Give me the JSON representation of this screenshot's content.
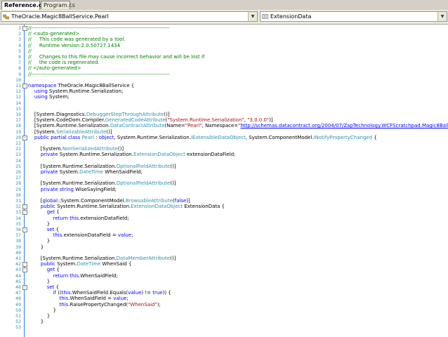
{
  "tabs": [
    {
      "label": "Reference.cs",
      "active": true
    },
    {
      "label": "Program.cs",
      "active": false
    }
  ],
  "type_combo": {
    "value": "TheOracle.Magic8BallService.Pearl",
    "icon": "class-icon"
  },
  "member_combo": {
    "value": "ExtensionData",
    "icon": "property-icon"
  },
  "lines": [
    {
      "n": "1",
      "fold": "-",
      "t": [
        [
          "c",
          "//------------------------------------------------------------------------------"
        ]
      ]
    },
    {
      "n": "2",
      "t": [
        [
          "c",
          "// <auto-generated>"
        ]
      ]
    },
    {
      "n": "3",
      "t": [
        [
          "c",
          "//     This code was generated by a tool."
        ]
      ]
    },
    {
      "n": "4",
      "t": [
        [
          "c",
          "//     Runtime Version:2.0.50727.1434"
        ]
      ]
    },
    {
      "n": "5",
      "t": [
        [
          "c",
          "//"
        ]
      ]
    },
    {
      "n": "6",
      "t": [
        [
          "c",
          "//     Changes to this file may cause incorrect behavior and will be lost if"
        ]
      ]
    },
    {
      "n": "7",
      "t": [
        [
          "c",
          "//     the code is regenerated."
        ]
      ]
    },
    {
      "n": "8",
      "t": [
        [
          "c",
          "// </auto-generated>"
        ]
      ]
    },
    {
      "n": "9",
      "t": [
        [
          "c",
          "//------------------------------------------------------------------------------"
        ]
      ]
    },
    {
      "n": "10",
      "t": []
    },
    {
      "n": "11",
      "fold": "-",
      "t": [
        [
          "k",
          "namespace"
        ],
        [
          "n",
          " TheOracle.Magic8BallService {"
        ]
      ]
    },
    {
      "n": "12",
      "t": [
        [
          "n",
          "    "
        ],
        [
          "k",
          "using"
        ],
        [
          "n",
          " System.Runtime.Serialization;"
        ]
      ]
    },
    {
      "n": "13",
      "t": [
        [
          "n",
          "    "
        ],
        [
          "k",
          "using"
        ],
        [
          "n",
          " System;"
        ]
      ]
    },
    {
      "n": "14",
      "t": []
    },
    {
      "n": "15",
      "t": []
    },
    {
      "n": "16",
      "t": [
        [
          "n",
          "    [System.Diagnostics."
        ],
        [
          "t",
          "DebuggerStepThroughAttribute"
        ],
        [
          "n",
          "()]"
        ]
      ]
    },
    {
      "n": "17",
      "t": [
        [
          "n",
          "    [System.CodeDom.Compiler."
        ],
        [
          "t",
          "GeneratedCodeAttribute"
        ],
        [
          "n",
          "("
        ],
        [
          "s",
          "\"System.Runtime.Serialization\""
        ],
        [
          "n",
          ", "
        ],
        [
          "s",
          "\"3.0.0.0\""
        ],
        [
          "n",
          ")]"
        ]
      ]
    },
    {
      "n": "18",
      "t": [
        [
          "n",
          "    [System.Runtime.Serialization."
        ],
        [
          "t",
          "DataContractAttribute"
        ],
        [
          "n",
          "(Name="
        ],
        [
          "s",
          "\"Pearl\""
        ],
        [
          "n",
          ", Namespace="
        ],
        [
          "s",
          "\""
        ],
        [
          "u",
          "http://schemas.datacontract.org/2004/07/ZapTechnology.WCFScratchpad.Magic8Ball"
        ],
        [
          "s",
          "\""
        ],
        [
          "n",
          ")]"
        ]
      ]
    },
    {
      "n": "19",
      "t": [
        [
          "n",
          "    [System."
        ],
        [
          "t",
          "SerializableAttribute"
        ],
        [
          "n",
          "()]"
        ]
      ]
    },
    {
      "n": "20",
      "fold": "-",
      "t": [
        [
          "n",
          "    "
        ],
        [
          "k",
          "public partial class"
        ],
        [
          "n",
          " "
        ],
        [
          "t",
          "Pearl"
        ],
        [
          "n",
          " : "
        ],
        [
          "k",
          "object"
        ],
        [
          "n",
          ", System.Runtime.Serialization."
        ],
        [
          "t",
          "IExtensibleDataObject"
        ],
        [
          "n",
          ", System.ComponentModel."
        ],
        [
          "t",
          "INotifyPropertyChanged"
        ],
        [
          "n",
          " {"
        ]
      ]
    },
    {
      "n": "21",
      "t": []
    },
    {
      "n": "22",
      "t": [
        [
          "n",
          "        [System."
        ],
        [
          "t",
          "NonSerializedAttribute"
        ],
        [
          "n",
          "()]"
        ]
      ]
    },
    {
      "n": "23",
      "t": [
        [
          "n",
          "        "
        ],
        [
          "k",
          "private"
        ],
        [
          "n",
          " System.Runtime.Serialization."
        ],
        [
          "t",
          "ExtensionDataObject"
        ],
        [
          "n",
          " extensionDataField;"
        ]
      ]
    },
    {
      "n": "24",
      "t": []
    },
    {
      "n": "25",
      "t": [
        [
          "n",
          "        [System.Runtime.Serialization."
        ],
        [
          "t",
          "OptionalFieldAttribute"
        ],
        [
          "n",
          "()]"
        ]
      ]
    },
    {
      "n": "26",
      "t": [
        [
          "n",
          "        "
        ],
        [
          "k",
          "private"
        ],
        [
          "n",
          " System."
        ],
        [
          "t",
          "DateTime"
        ],
        [
          "n",
          " WhenSaidField;"
        ]
      ]
    },
    {
      "n": "27",
      "t": []
    },
    {
      "n": "28",
      "t": [
        [
          "n",
          "        [System.Runtime.Serialization."
        ],
        [
          "t",
          "OptionalFieldAttribute"
        ],
        [
          "n",
          "()]"
        ]
      ]
    },
    {
      "n": "29",
      "t": [
        [
          "n",
          "        "
        ],
        [
          "k",
          "private string"
        ],
        [
          "n",
          " WiseSayingField;"
        ]
      ]
    },
    {
      "n": "30",
      "t": []
    },
    {
      "n": "31",
      "t": [
        [
          "n",
          "        ["
        ],
        [
          "k",
          "global"
        ],
        [
          "n",
          "::System.ComponentModel."
        ],
        [
          "t",
          "BrowsableAttribute"
        ],
        [
          "n",
          "("
        ],
        [
          "k",
          "false"
        ],
        [
          "n",
          ")]"
        ]
      ]
    },
    {
      "n": "32",
      "fold": "-",
      "t": [
        [
          "n",
          "        "
        ],
        [
          "k",
          "public"
        ],
        [
          "n",
          " System.Runtime.Serialization."
        ],
        [
          "t",
          "ExtensionDataObject"
        ],
        [
          "n",
          " ExtensionData {"
        ]
      ]
    },
    {
      "n": "33",
      "fold": "-",
      "t": [
        [
          "n",
          "            "
        ],
        [
          "k",
          "get"
        ],
        [
          "n",
          " {"
        ]
      ]
    },
    {
      "n": "34",
      "t": [
        [
          "n",
          "                "
        ],
        [
          "k",
          "return this"
        ],
        [
          "n",
          ".extensionDataField;"
        ]
      ]
    },
    {
      "n": "35",
      "t": [
        [
          "n",
          "            }"
        ]
      ]
    },
    {
      "n": "36",
      "fold": "-",
      "t": [
        [
          "n",
          "            "
        ],
        [
          "k",
          "set"
        ],
        [
          "n",
          " {"
        ]
      ]
    },
    {
      "n": "37",
      "t": [
        [
          "n",
          "                "
        ],
        [
          "k",
          "this"
        ],
        [
          "n",
          ".extensionDataField = "
        ],
        [
          "k",
          "value"
        ],
        [
          "n",
          ";"
        ]
      ]
    },
    {
      "n": "38",
      "t": [
        [
          "n",
          "            }"
        ]
      ]
    },
    {
      "n": "39",
      "t": [
        [
          "n",
          "        }"
        ]
      ]
    },
    {
      "n": "40",
      "t": []
    },
    {
      "n": "41",
      "t": [
        [
          "n",
          "        [System.Runtime.Serialization."
        ],
        [
          "t",
          "DataMemberAttribute"
        ],
        [
          "n",
          "()]"
        ]
      ]
    },
    {
      "n": "42",
      "fold": "-",
      "t": [
        [
          "n",
          "        "
        ],
        [
          "k",
          "public"
        ],
        [
          "n",
          " System."
        ],
        [
          "t",
          "DateTime"
        ],
        [
          "n",
          " WhenSaid {"
        ]
      ]
    },
    {
      "n": "43",
      "fold": "-",
      "t": [
        [
          "n",
          "            "
        ],
        [
          "k",
          "get"
        ],
        [
          "n",
          " {"
        ]
      ]
    },
    {
      "n": "44",
      "t": [
        [
          "n",
          "                "
        ],
        [
          "k",
          "return this"
        ],
        [
          "n",
          ".WhenSaidField;"
        ]
      ]
    },
    {
      "n": "45",
      "t": [
        [
          "n",
          "            }"
        ]
      ]
    },
    {
      "n": "46",
      "fold": "-",
      "t": [
        [
          "n",
          "            "
        ],
        [
          "k",
          "set"
        ],
        [
          "n",
          " {"
        ]
      ]
    },
    {
      "n": "47",
      "t": [
        [
          "n",
          "                "
        ],
        [
          "k",
          "if"
        ],
        [
          "n",
          " (("
        ],
        [
          "k",
          "this"
        ],
        [
          "n",
          ".WhenSaidField.Equals("
        ],
        [
          "k",
          "value"
        ],
        [
          "n",
          ") != "
        ],
        [
          "k",
          "true"
        ],
        [
          "n",
          ")) {"
        ]
      ]
    },
    {
      "n": "48",
      "t": [
        [
          "n",
          "                    "
        ],
        [
          "k",
          "this"
        ],
        [
          "n",
          ".WhenSaidField = "
        ],
        [
          "k",
          "value"
        ],
        [
          "n",
          ";"
        ]
      ]
    },
    {
      "n": "49",
      "t": [
        [
          "n",
          "                    "
        ],
        [
          "k",
          "this"
        ],
        [
          "n",
          ".RaisePropertyChanged("
        ],
        [
          "s",
          "\"WhenSaid\""
        ],
        [
          "n",
          ");"
        ]
      ]
    },
    {
      "n": "50",
      "t": [
        [
          "n",
          "                }"
        ]
      ]
    },
    {
      "n": "51",
      "t": [
        [
          "n",
          "            }"
        ]
      ]
    },
    {
      "n": "52",
      "t": [
        [
          "n",
          "        }"
        ]
      ]
    },
    {
      "n": "53",
      "t": []
    }
  ]
}
